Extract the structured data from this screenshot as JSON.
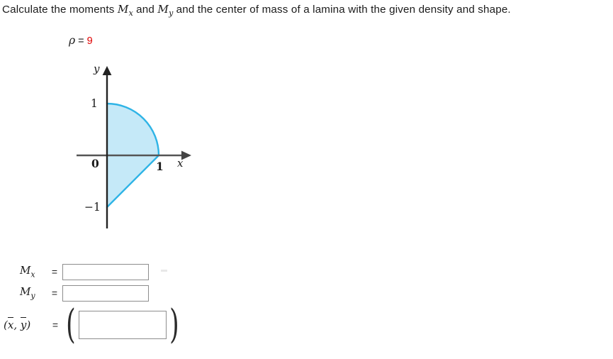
{
  "prompt": {
    "part1": "Calculate the moments ",
    "m1": "M",
    "m1sub": "x",
    "part2": " and ",
    "m2": "M",
    "m2sub": "y",
    "part3": " and the center of mass of a lamina with the given density and shape."
  },
  "density": {
    "symbol": "ρ",
    "equals": "=",
    "value": "9"
  },
  "figure": {
    "axis_labels": {
      "y_axis": "y",
      "x_axis": "x",
      "origin": "0",
      "y_one": "1",
      "y_minus_one": "−1",
      "x_one": "1"
    },
    "colors": {
      "fill": "#c5e9f8",
      "stroke": "#2fb4e6",
      "axis": "#555555",
      "text": "#1b1b1b"
    },
    "shape_description": "quarter-circle arc from (0,1) to (1,0) plus straight segment from (1,0) to (0,-1), closed along the y-axis",
    "chart_data": {
      "type": "area",
      "title": "",
      "xlabel": "x",
      "ylabel": "y",
      "xlim": [
        -0.6,
        1.45
      ],
      "ylim": [
        -1.38,
        1.42
      ],
      "xticks": [
        1
      ],
      "yticks": [
        -1,
        0,
        1
      ],
      "xticklabels": [
        "1"
      ],
      "yticklabels": [
        "−1",
        "0",
        "1"
      ],
      "grid": false,
      "legend": null,
      "boundary_vertices": [
        [
          0,
          1
        ],
        [
          1,
          0
        ],
        [
          0,
          -1
        ],
        [
          0,
          1
        ]
      ],
      "arc": {
        "center": [
          0,
          0
        ],
        "radius": 1,
        "start_angle_deg": 90,
        "end_angle_deg": 0
      },
      "segment": {
        "from": [
          1,
          0
        ],
        "to": [
          0,
          -1
        ]
      }
    }
  },
  "answers": {
    "mx": {
      "label_base": "M",
      "label_sub": "x",
      "equals": "=",
      "value": "",
      "placeholder": ""
    },
    "my": {
      "label_base": "M",
      "label_sub": "y",
      "equals": "=",
      "value": "",
      "placeholder": ""
    },
    "centroid": {
      "label_x": "x",
      "label_y": "y",
      "comma": ", ",
      "open_paren": "(",
      "close_paren": ")",
      "equals": "=",
      "big_open": "(",
      "big_close": ")",
      "value": "",
      "placeholder": ""
    }
  }
}
